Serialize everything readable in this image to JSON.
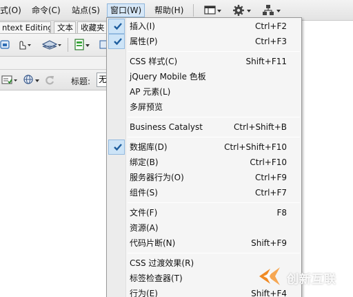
{
  "menubar": {
    "items": [
      {
        "label": "式(O)"
      },
      {
        "label": "命令(C)"
      },
      {
        "label": "站点(S)"
      },
      {
        "label": "窗口(W)"
      },
      {
        "label": "帮助(H)"
      }
    ],
    "icons": [
      "layout-icon",
      "gear-icon",
      "site-icon"
    ]
  },
  "document_tabs": {
    "items": [
      {
        "label": "ntext Editing"
      },
      {
        "label": "文本"
      },
      {
        "label": "收藏夹"
      }
    ]
  },
  "title_bar": {
    "label": "标题:",
    "value": "无"
  },
  "window_menu": {
    "items": [
      {
        "label": "插入(I)",
        "shortcut": "Ctrl+F2",
        "checked": true
      },
      {
        "label": "属性(P)",
        "shortcut": "Ctrl+F3",
        "checked": true
      },
      {
        "label": "CSS 样式(C)",
        "shortcut": "Shift+F11",
        "checked": false
      },
      {
        "label": "jQuery Mobile 色板",
        "shortcut": "",
        "checked": false
      },
      {
        "label": "AP 元素(L)",
        "shortcut": "",
        "checked": false
      },
      {
        "label": "多屏预览",
        "shortcut": "",
        "checked": false
      },
      {
        "label": "Business Catalyst",
        "shortcut": "Ctrl+Shift+B",
        "checked": false
      },
      {
        "label": "数据库(D)",
        "shortcut": "Ctrl+Shift+F10",
        "checked": true
      },
      {
        "label": "绑定(B)",
        "shortcut": "Ctrl+F10",
        "checked": false
      },
      {
        "label": "服务器行为(O)",
        "shortcut": "Ctrl+F9",
        "checked": false
      },
      {
        "label": "组件(S)",
        "shortcut": "Ctrl+F7",
        "checked": false
      },
      {
        "label": "文件(F)",
        "shortcut": "F8",
        "checked": false
      },
      {
        "label": "资源(A)",
        "shortcut": "",
        "checked": false
      },
      {
        "label": "代码片断(N)",
        "shortcut": "Shift+F9",
        "checked": false
      },
      {
        "label": "CSS 过渡效果(R)",
        "shortcut": "",
        "checked": false
      },
      {
        "label": "标签检查器(T)",
        "shortcut": "",
        "checked": false
      },
      {
        "label": "行为(E)",
        "shortcut": "Shift+F4",
        "checked": false
      }
    ]
  },
  "watermark": {
    "text": "创新互联",
    "logo": "brand-logo-icon"
  },
  "colors": {
    "menubar_bg": "#e9e9e9",
    "menu_bg": "#f5f5f5",
    "check_highlight": "#cde4f7",
    "check_border": "#92b9df",
    "check_mark": "#1d5d9e",
    "watermark_orange": "#f08a24"
  }
}
